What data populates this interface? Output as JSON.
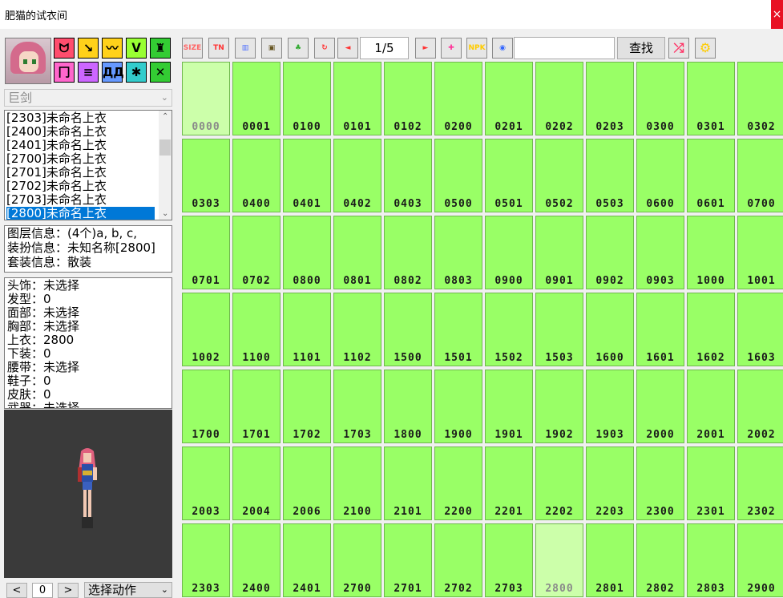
{
  "window": {
    "title": "肥猫的试衣间",
    "close_label": "×"
  },
  "avatar": {
    "icon": "character-portrait-icon"
  },
  "category_buttons": [
    {
      "name": "cat-hat-icon",
      "glyph": "ᗢ",
      "color": "#ff4d6d"
    },
    {
      "name": "cat-hair-icon",
      "glyph": "↘",
      "color": "#ffd11a"
    },
    {
      "name": "cat-face-icon",
      "glyph": "〰",
      "color": "#ffd11a"
    },
    {
      "name": "cat-neck-icon",
      "glyph": "ᐯ",
      "color": "#99ff33"
    },
    {
      "name": "cat-coat-icon",
      "glyph": "♜",
      "color": "#33cc33"
    },
    {
      "name": "cat-pants-icon",
      "glyph": "冂",
      "color": "#ff66cc"
    },
    {
      "name": "cat-belt-icon",
      "glyph": "≡",
      "color": "#cc66ff"
    },
    {
      "name": "cat-shoes-icon",
      "glyph": "ДД",
      "color": "#6699ff"
    },
    {
      "name": "cat-skin-icon",
      "glyph": "✱",
      "color": "#33cccc"
    },
    {
      "name": "cat-weapon-icon",
      "glyph": "✕",
      "color": "#33cc33"
    }
  ],
  "toolbar": [
    {
      "name": "size-icon",
      "glyph": "SIZE",
      "color": "#ff6666"
    },
    {
      "name": "tn-icon",
      "glyph": "TN",
      "color": "#ff3333"
    },
    {
      "name": "book-icon",
      "glyph": "▥",
      "color": "#4d6fff"
    },
    {
      "name": "film-icon",
      "glyph": "▣",
      "color": "#665522"
    },
    {
      "name": "shirt-icon",
      "glyph": "♣",
      "color": "#33aa33"
    },
    {
      "name": "refresh-icon",
      "glyph": "↻",
      "color": "#ff3333"
    },
    {
      "name": "back-icon",
      "glyph": "◄",
      "color": "#ff3333"
    },
    {
      "name": "export-icon",
      "glyph": "►",
      "color": "#ff3333"
    },
    {
      "name": "gift-icon",
      "glyph": "✚",
      "color": "#ff3399"
    },
    {
      "name": "npk-icon",
      "glyph": "NPK",
      "color": "#ffcc00"
    },
    {
      "name": "globe-icon",
      "glyph": "◉",
      "color": "#3366ff"
    }
  ],
  "pager": {
    "value": "1/5"
  },
  "search": {
    "placeholder": "",
    "button_label": "查找"
  },
  "extra_tools": [
    {
      "name": "shuffle-icon",
      "glyph": "⤮",
      "color": "#ff3366"
    },
    {
      "name": "gear-icon",
      "glyph": "⚙",
      "color": "#ffcc00"
    }
  ],
  "weapon_combo": {
    "value": "巨剑",
    "arrow": "⌄"
  },
  "item_list": {
    "items": [
      "[2303]未命名上衣",
      "[2400]未命名上衣",
      "[2401]未命名上衣",
      "[2700]未命名上衣",
      "[2701]未命名上衣",
      "[2702]未命名上衣",
      "[2703]未命名上衣",
      "[2800]未命名上衣"
    ],
    "selected_index": 7,
    "scroll_up": "⌃",
    "scroll_down": "⌄"
  },
  "layer_info": {
    "lines": [
      "图层信息：(4个)a, b, c,",
      "装扮信息：未知名称[2800]",
      "套装信息：散装"
    ]
  },
  "parts_info": {
    "lines": [
      "头饰：未选择",
      "发型：0",
      "面部：未选择",
      "胸部：未选择",
      "上衣：2800",
      "下装：0",
      "腰带：未选择",
      "鞋子：0",
      "皮肤：0",
      "武器：未选择"
    ]
  },
  "frame_nav": {
    "prev": "<",
    "value": "0",
    "next": ">"
  },
  "action_combo": {
    "value": "选择动作",
    "arrow": "⌄"
  },
  "grid": {
    "columns": 12,
    "dim_codes": [
      "0000",
      "2800"
    ],
    "codes": [
      "0000",
      "0001",
      "0100",
      "0101",
      "0102",
      "0200",
      "0201",
      "0202",
      "0203",
      "0300",
      "0301",
      "0302",
      "0303",
      "0400",
      "0401",
      "0402",
      "0403",
      "0500",
      "0501",
      "0502",
      "0503",
      "0600",
      "0601",
      "0700",
      "0701",
      "0702",
      "0800",
      "0801",
      "0802",
      "0803",
      "0900",
      "0901",
      "0902",
      "0903",
      "1000",
      "1001",
      "1002",
      "1100",
      "1101",
      "1102",
      "1500",
      "1501",
      "1502",
      "1503",
      "1600",
      "1601",
      "1602",
      "1603",
      "1700",
      "1701",
      "1702",
      "1703",
      "1800",
      "1900",
      "1901",
      "1902",
      "1903",
      "2000",
      "2001",
      "2002",
      "2003",
      "2004",
      "2006",
      "2100",
      "2101",
      "2200",
      "2201",
      "2202",
      "2203",
      "2300",
      "2301",
      "2302",
      "2303",
      "2400",
      "2401",
      "2700",
      "2701",
      "2702",
      "2703",
      "2800",
      "2801",
      "2802",
      "2803",
      "2900"
    ]
  }
}
